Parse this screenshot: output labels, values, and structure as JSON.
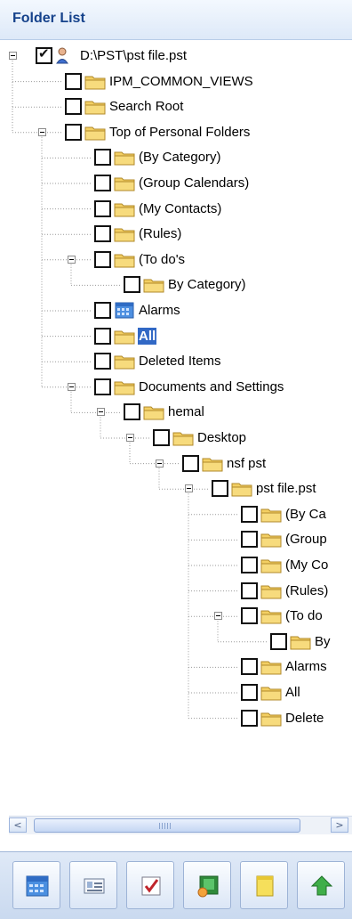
{
  "header": {
    "title": "Folder List"
  },
  "tree": {
    "nodes": [
      {
        "label": "D:\\PST\\pst file.pst",
        "icon": "pst-file-icon",
        "checked": true,
        "expanded": true
      },
      {
        "label": "IPM_COMMON_VIEWS",
        "icon": "folder-icon"
      },
      {
        "label": "Search Root",
        "icon": "folder-icon"
      },
      {
        "label": "Top of Personal Folders",
        "icon": "folder-icon",
        "expanded": true
      },
      {
        "label": "(By Category)",
        "icon": "folder-icon"
      },
      {
        "label": "(Group Calendars)",
        "icon": "folder-icon"
      },
      {
        "label": "(My Contacts)",
        "icon": "folder-icon"
      },
      {
        "label": "(Rules)",
        "icon": "folder-icon"
      },
      {
        "label": "(To do's",
        "icon": "folder-icon",
        "expanded": true
      },
      {
        "label": "By Category)",
        "icon": "folder-icon"
      },
      {
        "label": "Alarms",
        "icon": "calendar-folder-icon"
      },
      {
        "label": "All",
        "icon": "folder-icon",
        "selected": true
      },
      {
        "label": "Deleted Items",
        "icon": "folder-icon"
      },
      {
        "label": "Documents and Settings",
        "icon": "folder-icon",
        "expanded": true
      },
      {
        "label": "hemal",
        "icon": "folder-icon",
        "expanded": true
      },
      {
        "label": "Desktop",
        "icon": "folder-icon",
        "expanded": true
      },
      {
        "label": "nsf pst",
        "icon": "folder-icon",
        "expanded": true
      },
      {
        "label": "pst file.pst",
        "icon": "folder-icon",
        "expanded": true
      },
      {
        "label": "(By Ca",
        "icon": "folder-icon"
      },
      {
        "label": "(Group",
        "icon": "folder-icon"
      },
      {
        "label": "(My Co",
        "icon": "folder-icon"
      },
      {
        "label": "(Rules)",
        "icon": "folder-icon"
      },
      {
        "label": "(To do",
        "icon": "folder-icon",
        "expanded": true
      },
      {
        "label": "By",
        "icon": "folder-icon"
      },
      {
        "label": "Alarms",
        "icon": "folder-icon"
      },
      {
        "label": "All",
        "icon": "folder-icon"
      },
      {
        "label": "Delete",
        "icon": "folder-icon"
      }
    ]
  },
  "scrollbar": {
    "left_arrow": "<",
    "right_arrow": ">"
  },
  "navbar": {
    "buttons": [
      {
        "name": "calendar-button",
        "icon": "calendar-icon"
      },
      {
        "name": "contacts-button",
        "icon": "contact-card-icon"
      },
      {
        "name": "tasks-button",
        "icon": "task-check-icon"
      },
      {
        "name": "journal-button",
        "icon": "journal-icon"
      },
      {
        "name": "notes-button",
        "icon": "note-icon"
      },
      {
        "name": "shortcuts-button",
        "icon": "up-arrow-icon"
      }
    ]
  },
  "colors": {
    "header_text": "#15428b",
    "selection": "#3168c5",
    "folder": "#f3cf63",
    "scrollbar_border": "#9cb4dd"
  }
}
